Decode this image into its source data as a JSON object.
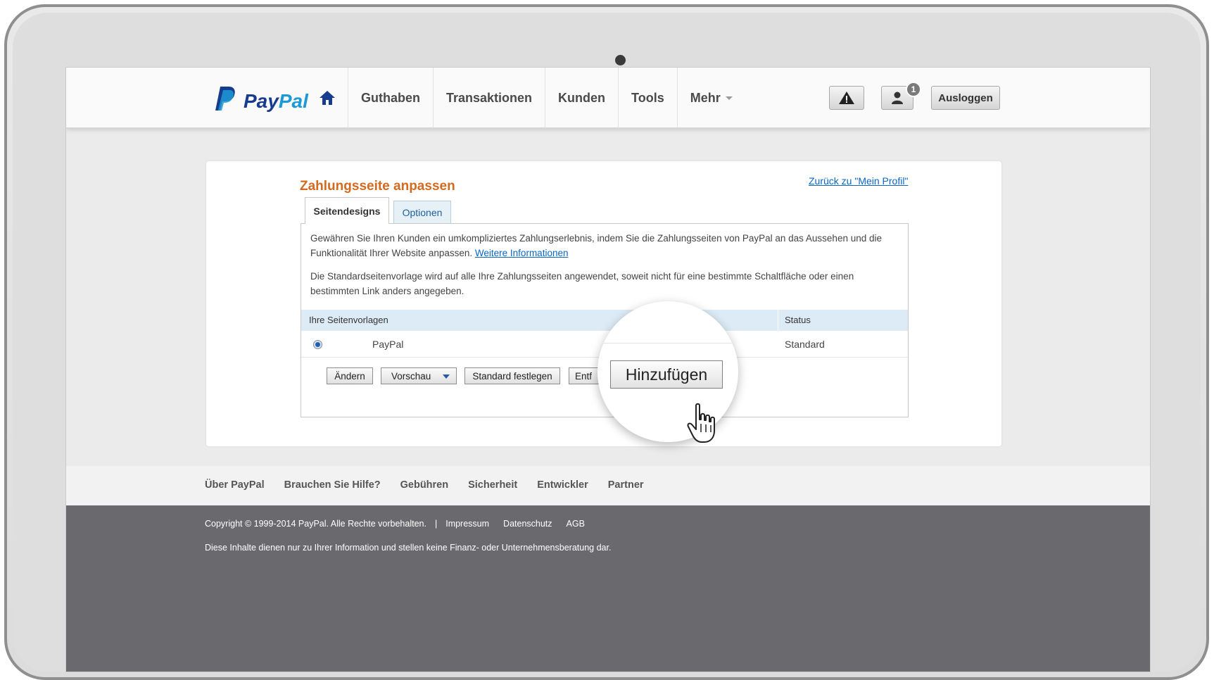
{
  "header": {
    "logo": {
      "pay": "Pay",
      "pal": "Pal"
    },
    "nav": [
      "Guthaben",
      "Transaktionen",
      "Kunden",
      "Tools",
      "Mehr"
    ],
    "notification_count": "1",
    "logout_label": "Ausloggen"
  },
  "panel": {
    "title": "Zahlungsseite anpassen",
    "back_link": "Zurück zu \"Mein Profil\"",
    "tabs": [
      {
        "label": "Seitendesigns",
        "active": true
      },
      {
        "label": "Optionen",
        "active": false
      }
    ],
    "paragraph1": "Gewähren Sie Ihren Kunden ein umkompliziertes Zahlungserlebnis, indem Sie die Zahlungsseiten von PayPal an das Aussehen und die Funktionalität Ihrer Website anpassen.",
    "more_info_link": "Weitere Informationen",
    "paragraph2": "Die Standardseitenvorlage wird auf alle Ihre Zahlungsseiten angewendet, soweit nicht für eine bestimmte Schaltfläche oder einen bestimmten Link anders angegeben.",
    "table": {
      "headers": [
        "Ihre Seitenvorlagen",
        "Status"
      ],
      "rows": [
        {
          "name": "PayPal",
          "status": "Standard",
          "selected": true
        }
      ]
    },
    "buttons": {
      "edit": "Ändern",
      "preview": "Vorschau",
      "set_default": "Standard festlegen",
      "remove_partial": "Entf"
    },
    "magnified_button": "Hinzufügen"
  },
  "footer": {
    "links": [
      "Über PayPal",
      "Brauchen Sie Hilfe?",
      "Gebühren",
      "Sicherheit",
      "Entwickler",
      "Partner"
    ],
    "copyright": "Copyright © 1999-2014 PayPal. Alle Rechte vorbehalten.",
    "separator": "|",
    "legal_links": [
      "Impressum",
      "Datenschutz",
      "AGB"
    ],
    "disclaimer": "Diese Inhalte dienen nur zu Ihrer Information und stellen keine Finanz- oder Unternehmensberatung dar."
  },
  "colors": {
    "paypal_dark_blue": "#173b8f",
    "paypal_light_blue": "#1d9ad6",
    "title_orange": "#d46a1f",
    "link_blue": "#0b66c3",
    "footer_dark": "#6a6a6e"
  }
}
